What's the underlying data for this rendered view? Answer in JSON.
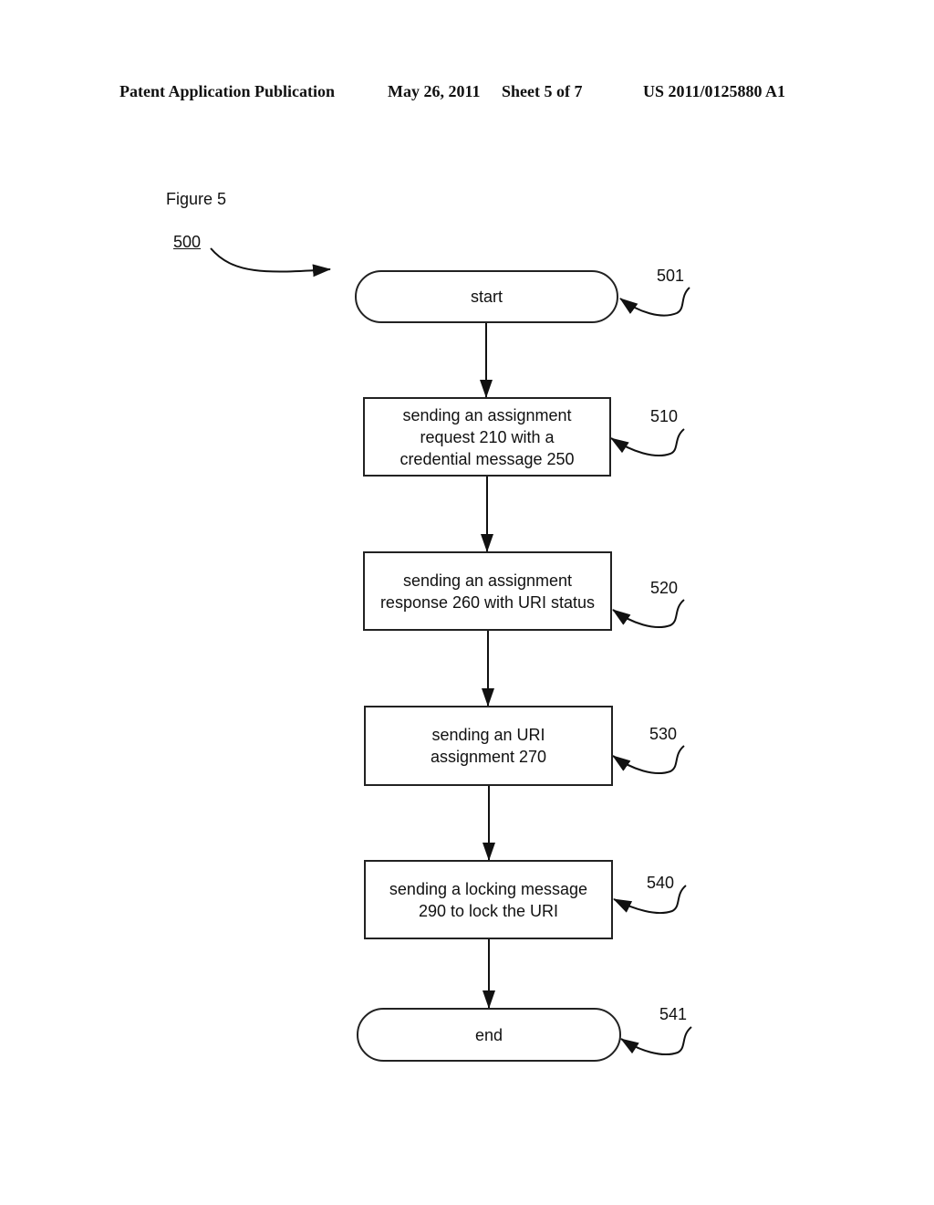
{
  "header": {
    "publication": "Patent Application Publication",
    "date": "May 26, 2011",
    "sheet": "Sheet 5 of 7",
    "number": "US 2011/0125880 A1"
  },
  "figure": {
    "title": "Figure 5",
    "id": "500"
  },
  "nodes": [
    {
      "ref": "501",
      "type": "terminal",
      "text": "start"
    },
    {
      "ref": "510",
      "type": "process",
      "text": "sending an assignment request 210 with a credential message 250"
    },
    {
      "ref": "520",
      "type": "process",
      "text": "sending an assignment response 260 with URI status"
    },
    {
      "ref": "530",
      "type": "process",
      "text": "sending an URI assignment 270"
    },
    {
      "ref": "540",
      "type": "process",
      "text": "sending a locking message 290 to lock the URI"
    },
    {
      "ref": "541",
      "type": "terminal",
      "text": "end"
    }
  ],
  "edges": [
    {
      "from": "501",
      "to": "510"
    },
    {
      "from": "510",
      "to": "520"
    },
    {
      "from": "520",
      "to": "530"
    },
    {
      "from": "530",
      "to": "540"
    },
    {
      "from": "540",
      "to": "541"
    }
  ]
}
